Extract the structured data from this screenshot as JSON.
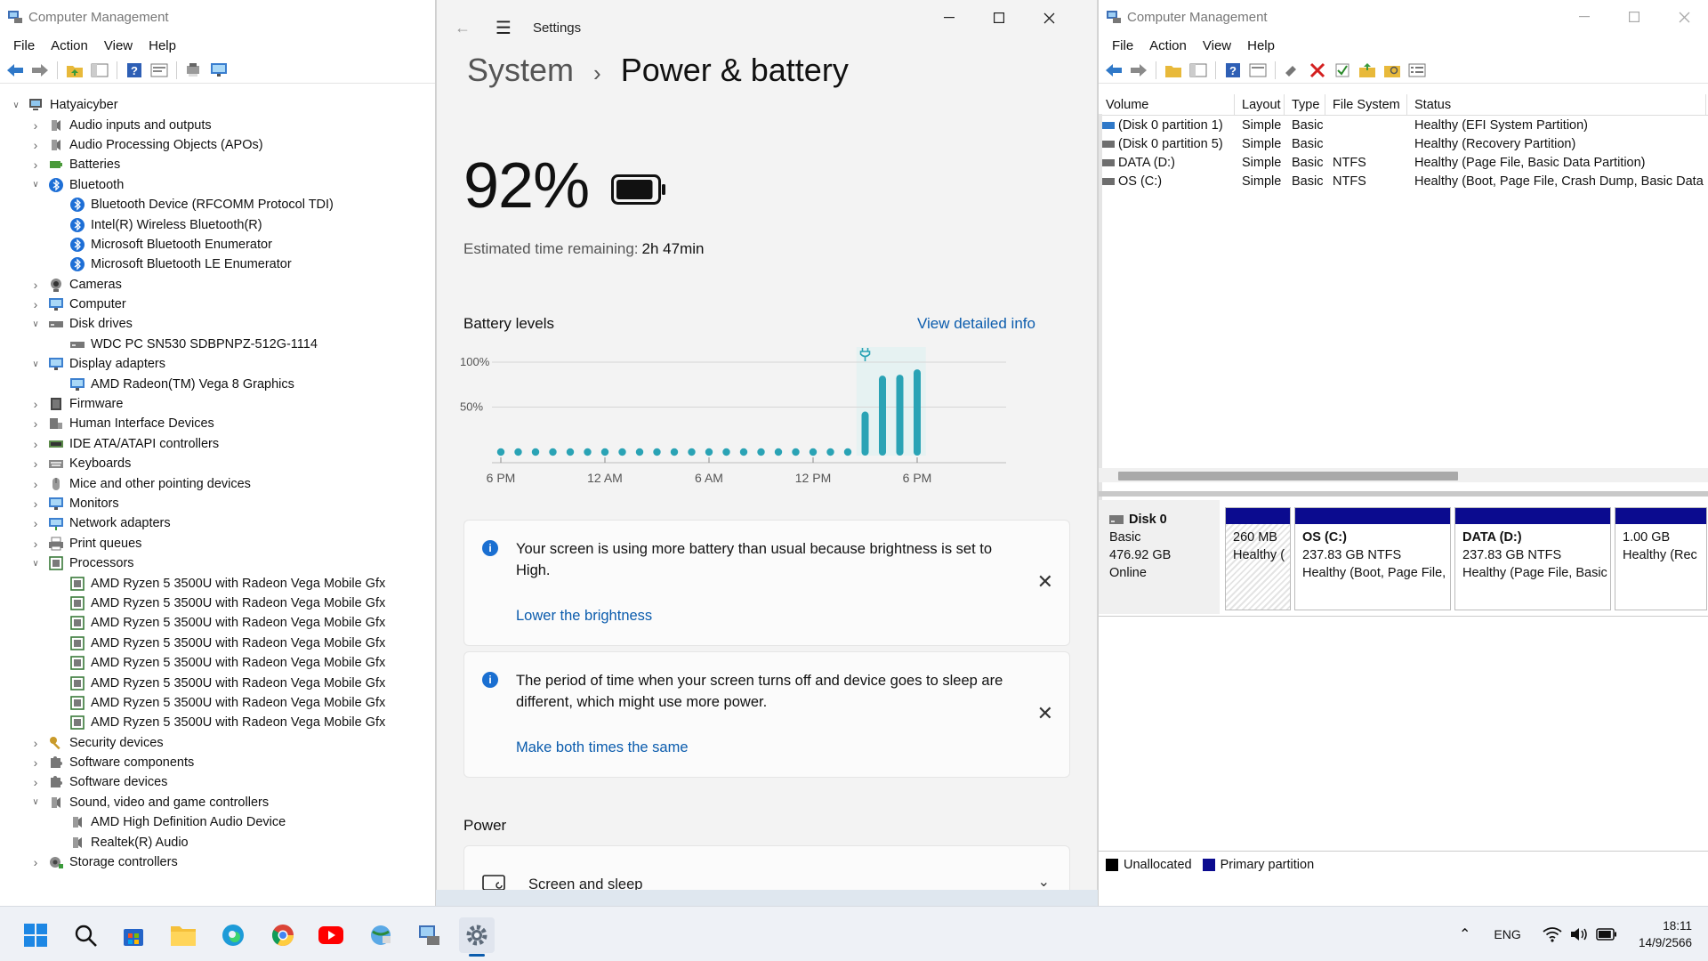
{
  "left": {
    "title": "Computer Management",
    "menu": [
      "File",
      "Action",
      "View",
      "Help"
    ],
    "tree": [
      {
        "level": 0,
        "chev": "v",
        "icon": "computer",
        "label": "Hatyaicyber"
      },
      {
        "level": 1,
        "chev": ">",
        "icon": "speaker",
        "label": "Audio inputs and outputs"
      },
      {
        "level": 1,
        "chev": ">",
        "icon": "speaker",
        "label": "Audio Processing Objects (APOs)"
      },
      {
        "level": 1,
        "chev": ">",
        "icon": "battery",
        "label": "Batteries"
      },
      {
        "level": 1,
        "chev": "v",
        "icon": "bluetooth",
        "label": "Bluetooth"
      },
      {
        "level": 2,
        "chev": "",
        "icon": "bluetooth",
        "label": "Bluetooth Device (RFCOMM Protocol TDI)"
      },
      {
        "level": 2,
        "chev": "",
        "icon": "bluetooth",
        "label": "Intel(R) Wireless Bluetooth(R)"
      },
      {
        "level": 2,
        "chev": "",
        "icon": "bluetooth",
        "label": "Microsoft Bluetooth Enumerator"
      },
      {
        "level": 2,
        "chev": "",
        "icon": "bluetooth",
        "label": "Microsoft Bluetooth LE Enumerator"
      },
      {
        "level": 1,
        "chev": ">",
        "icon": "camera",
        "label": "Cameras"
      },
      {
        "level": 1,
        "chev": ">",
        "icon": "monitor",
        "label": "Computer"
      },
      {
        "level": 1,
        "chev": "v",
        "icon": "disk",
        "label": "Disk drives"
      },
      {
        "level": 2,
        "chev": "",
        "icon": "disk",
        "label": "WDC PC SN530 SDBPNPZ-512G-1114"
      },
      {
        "level": 1,
        "chev": "v",
        "icon": "monitor",
        "label": "Display adapters"
      },
      {
        "level": 2,
        "chev": "",
        "icon": "monitor",
        "label": "AMD Radeon(TM) Vega 8 Graphics"
      },
      {
        "level": 1,
        "chev": ">",
        "icon": "chip",
        "label": "Firmware"
      },
      {
        "level": 1,
        "chev": ">",
        "icon": "hid",
        "label": "Human Interface Devices"
      },
      {
        "level": 1,
        "chev": ">",
        "icon": "ide",
        "label": "IDE ATA/ATAPI controllers"
      },
      {
        "level": 1,
        "chev": ">",
        "icon": "keyboard",
        "label": "Keyboards"
      },
      {
        "level": 1,
        "chev": ">",
        "icon": "mouse",
        "label": "Mice and other pointing devices"
      },
      {
        "level": 1,
        "chev": ">",
        "icon": "monitor",
        "label": "Monitors"
      },
      {
        "level": 1,
        "chev": ">",
        "icon": "network",
        "label": "Network adapters"
      },
      {
        "level": 1,
        "chev": ">",
        "icon": "printer",
        "label": "Print queues"
      },
      {
        "level": 1,
        "chev": "v",
        "icon": "cpu",
        "label": "Processors"
      },
      {
        "level": 2,
        "chev": "",
        "icon": "cpu",
        "label": "AMD Ryzen 5 3500U with Radeon Vega Mobile Gfx"
      },
      {
        "level": 2,
        "chev": "",
        "icon": "cpu",
        "label": "AMD Ryzen 5 3500U with Radeon Vega Mobile Gfx"
      },
      {
        "level": 2,
        "chev": "",
        "icon": "cpu",
        "label": "AMD Ryzen 5 3500U with Radeon Vega Mobile Gfx"
      },
      {
        "level": 2,
        "chev": "",
        "icon": "cpu",
        "label": "AMD Ryzen 5 3500U with Radeon Vega Mobile Gfx"
      },
      {
        "level": 2,
        "chev": "",
        "icon": "cpu",
        "label": "AMD Ryzen 5 3500U with Radeon Vega Mobile Gfx"
      },
      {
        "level": 2,
        "chev": "",
        "icon": "cpu",
        "label": "AMD Ryzen 5 3500U with Radeon Vega Mobile Gfx"
      },
      {
        "level": 2,
        "chev": "",
        "icon": "cpu",
        "label": "AMD Ryzen 5 3500U with Radeon Vega Mobile Gfx"
      },
      {
        "level": 2,
        "chev": "",
        "icon": "cpu",
        "label": "AMD Ryzen 5 3500U with Radeon Vega Mobile Gfx"
      },
      {
        "level": 1,
        "chev": ">",
        "icon": "key",
        "label": "Security devices"
      },
      {
        "level": 1,
        "chev": ">",
        "icon": "puzzle",
        "label": "Software components"
      },
      {
        "level": 1,
        "chev": ">",
        "icon": "puzzle",
        "label": "Software devices"
      },
      {
        "level": 1,
        "chev": "v",
        "icon": "speaker",
        "label": "Sound, video and game controllers"
      },
      {
        "level": 2,
        "chev": "",
        "icon": "speaker",
        "label": "AMD High Definition Audio Device"
      },
      {
        "level": 2,
        "chev": "",
        "icon": "speaker",
        "label": "Realtek(R) Audio"
      },
      {
        "level": 1,
        "chev": ">",
        "icon": "storage",
        "label": "Storage controllers"
      }
    ]
  },
  "settings": {
    "app_name": "Settings",
    "breadcrumb_parent": "System",
    "breadcrumb_current": "Power & battery",
    "battery_percent": "92%",
    "battery_level": 0.92,
    "estimate_label": "Estimated time remaining:",
    "estimate_value": "2h 47min",
    "levels_title": "Battery levels",
    "view_detailed": "View detailed info",
    "cards": [
      {
        "text": "Your screen is using more battery than usual because brightness is set to High.",
        "action": "Lower the brightness"
      },
      {
        "text": "The period of time when your screen turns off and device goes to sleep are different, which might use more power.",
        "action": "Make both times the same"
      }
    ],
    "power_title": "Power",
    "screen_sleep": "Screen and sleep"
  },
  "chart_data": {
    "type": "bar",
    "title": "Battery levels",
    "y_ticks": [
      "100%",
      "50%"
    ],
    "x_ticks": [
      "6 PM",
      "12 AM",
      "6 AM",
      "12 PM",
      "6 PM"
    ],
    "ylim": [
      0,
      100
    ],
    "values": [
      0,
      0,
      0,
      0,
      0,
      0,
      0,
      0,
      0,
      0,
      0,
      0,
      0,
      0,
      0,
      0,
      0,
      0,
      0,
      0,
      0,
      45,
      85,
      86,
      92
    ],
    "charging_from_index": 21,
    "bar_color": "#2aa3b5"
  },
  "right": {
    "title": "Computer Management",
    "menu": [
      "File",
      "Action",
      "View",
      "Help"
    ],
    "columns": [
      "Volume",
      "Layout",
      "Type",
      "File System",
      "Status"
    ],
    "volumes": [
      {
        "volume": "(Disk 0 partition 1)",
        "layout": "Simple",
        "type": "Basic",
        "fs": "",
        "status": "Healthy (EFI System Partition)"
      },
      {
        "volume": "(Disk 0 partition 5)",
        "layout": "Simple",
        "type": "Basic",
        "fs": "",
        "status": "Healthy (Recovery Partition)"
      },
      {
        "volume": "DATA (D:)",
        "layout": "Simple",
        "type": "Basic",
        "fs": "NTFS",
        "status": "Healthy (Page File, Basic Data Partition)"
      },
      {
        "volume": "OS (C:)",
        "layout": "Simple",
        "type": "Basic",
        "fs": "NTFS",
        "status": "Healthy (Boot, Page File, Crash Dump, Basic Data"
      }
    ],
    "disk": {
      "name": "Disk 0",
      "kind": "Basic",
      "size": "476.92 GB",
      "state": "Online"
    },
    "partitions": [
      {
        "name": "",
        "size": "260 MB",
        "status": "Healthy ("
      },
      {
        "name": "OS  (C:)",
        "size": "237.83 GB NTFS",
        "status": "Healthy (Boot, Page File,"
      },
      {
        "name": "DATA  (D:)",
        "size": "237.83 GB NTFS",
        "status": "Healthy (Page File, Basic"
      },
      {
        "name": "",
        "size": "1.00 GB",
        "status": "Healthy (Rec"
      }
    ],
    "legend": [
      {
        "label": "Unallocated",
        "color": "#000000"
      },
      {
        "label": "Primary partition",
        "color": "#0b0b8f"
      }
    ]
  },
  "taskbar": {
    "lang": "ENG",
    "time": "18:11",
    "date": "14/9/2566"
  }
}
